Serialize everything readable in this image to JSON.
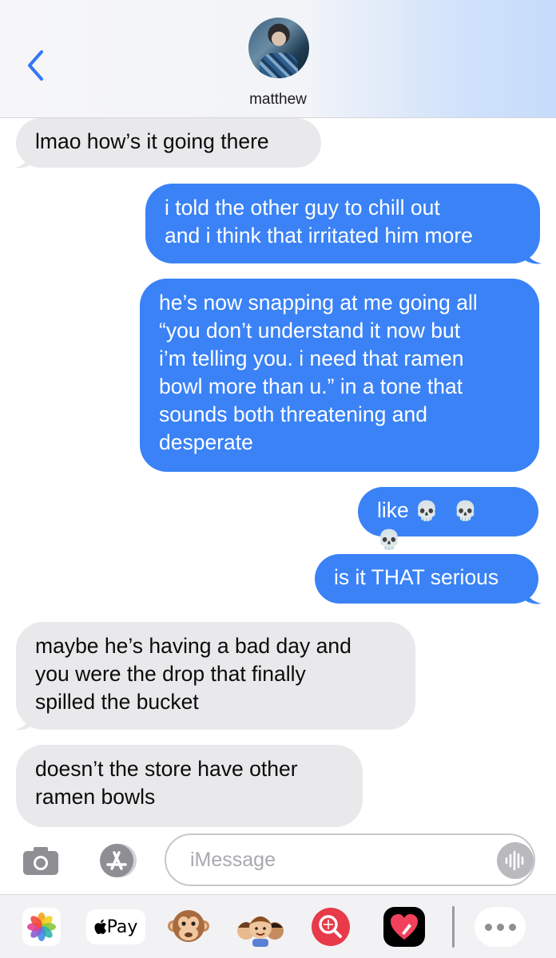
{
  "header": {
    "contact_name": "matthew",
    "back_icon": "chevron-left-icon",
    "accent_color": "#3478f6"
  },
  "messages": [
    {
      "side": "in",
      "lines": [
        "lmao how’s it going there"
      ]
    },
    {
      "side": "out",
      "lines": [
        "i told the other guy to chill out",
        "and i think that irritated him more"
      ]
    },
    {
      "side": "out",
      "lines": [
        "he’s now snapping at me going all",
        "“you don’t understand it now but",
        "i’m telling you. i need that ramen",
        "bowl more than u.” in a tone that",
        "sounds both threatening and",
        "desperate"
      ]
    },
    {
      "side": "out",
      "lines": [
        "like"
      ],
      "emoji": "💀 💀 💀"
    },
    {
      "side": "out",
      "lines": [
        "is it THAT serious"
      ]
    },
    {
      "side": "in",
      "lines": [
        "maybe he’s having a bad day and",
        "you were the drop that finally",
        "spilled the bucket"
      ]
    },
    {
      "side": "in",
      "lines": [
        "doesn’t the store have other",
        "ramen bowls"
      ]
    }
  ],
  "input": {
    "placeholder": "iMessage",
    "value": ""
  },
  "drawer": {
    "apps": [
      "photos-icon",
      "apple-pay",
      "animoji-icon",
      "memoji-icon",
      "images-search-icon",
      "digital-touch-icon",
      "more-icon"
    ],
    "applepay_label": " Pay"
  },
  "colors": {
    "outgoing_bubble": "#3a82f6",
    "incoming_bubble": "#e9e9eb"
  }
}
